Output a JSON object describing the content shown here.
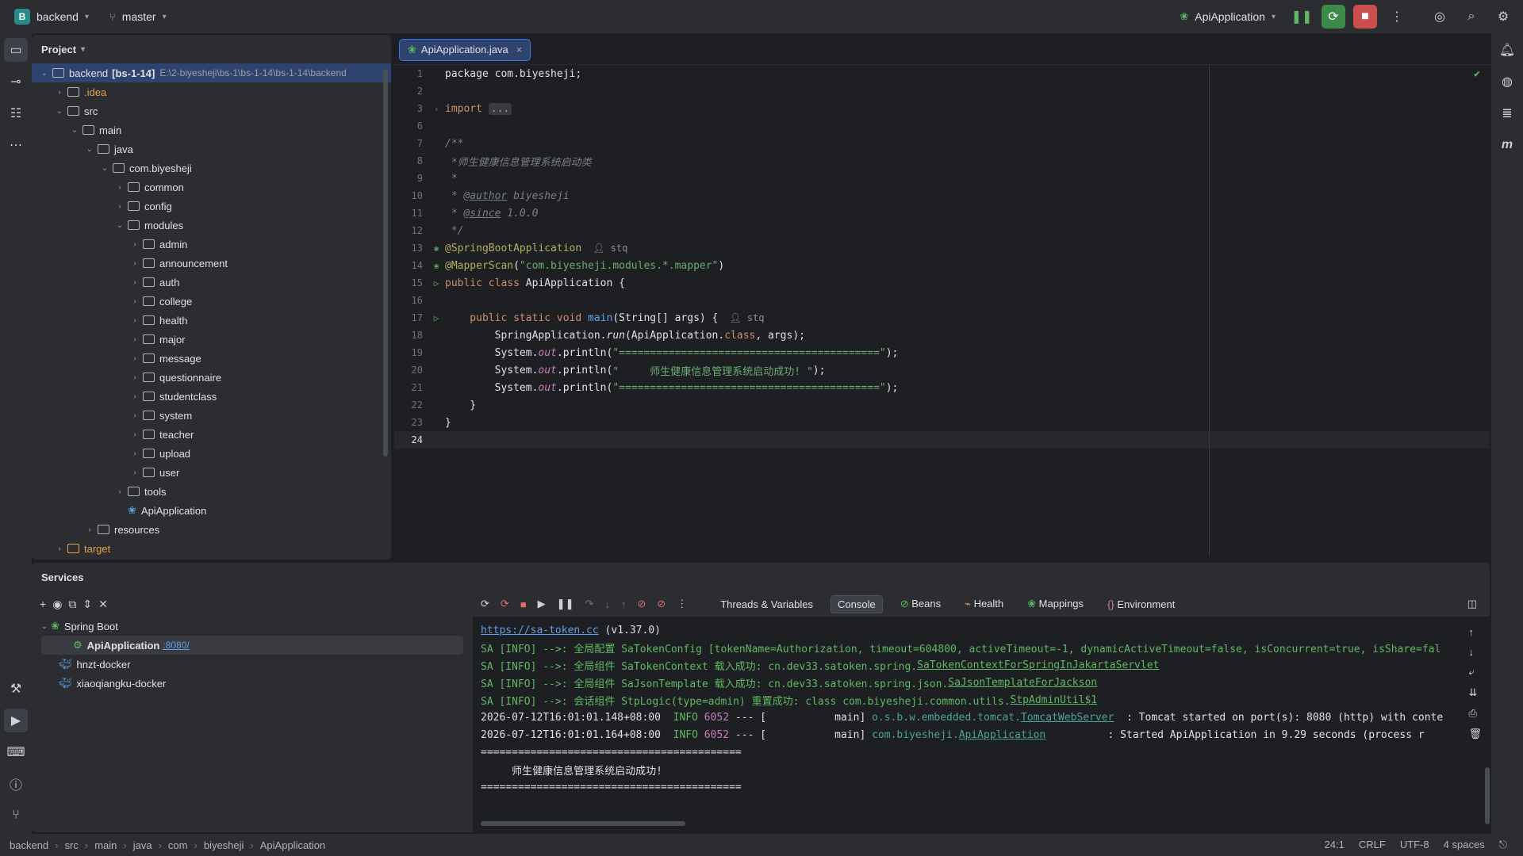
{
  "titlebar": {
    "project_badge": "B",
    "project_name": "backend",
    "branch_name": "master",
    "run_config": "ApiApplication"
  },
  "project_panel": {
    "title": "Project",
    "root_label": "backend",
    "root_module": "[bs-1-14]",
    "root_path": "E:\\2-biyesheji\\bs-1\\bs-1-14\\bs-1-14\\backend",
    "items": [
      {
        "label": ".idea",
        "depth": 1,
        "expanded": false,
        "type": "folder"
      },
      {
        "label": "src",
        "depth": 1,
        "expanded": true,
        "type": "folder"
      },
      {
        "label": "main",
        "depth": 2,
        "expanded": true,
        "type": "folder"
      },
      {
        "label": "java",
        "depth": 3,
        "expanded": true,
        "type": "folder"
      },
      {
        "label": "com.biyesheji",
        "depth": 4,
        "expanded": true,
        "type": "package"
      },
      {
        "label": "common",
        "depth": 5,
        "expanded": false,
        "type": "package"
      },
      {
        "label": "config",
        "depth": 5,
        "expanded": false,
        "type": "package"
      },
      {
        "label": "modules",
        "depth": 5,
        "expanded": true,
        "type": "package"
      },
      {
        "label": "admin",
        "depth": 6,
        "expanded": false,
        "type": "package"
      },
      {
        "label": "announcement",
        "depth": 6,
        "expanded": false,
        "type": "package"
      },
      {
        "label": "auth",
        "depth": 6,
        "expanded": false,
        "type": "package"
      },
      {
        "label": "college",
        "depth": 6,
        "expanded": false,
        "type": "package"
      },
      {
        "label": "health",
        "depth": 6,
        "expanded": false,
        "type": "package"
      },
      {
        "label": "major",
        "depth": 6,
        "expanded": false,
        "type": "package"
      },
      {
        "label": "message",
        "depth": 6,
        "expanded": false,
        "type": "package"
      },
      {
        "label": "questionnaire",
        "depth": 6,
        "expanded": false,
        "type": "package"
      },
      {
        "label": "studentclass",
        "depth": 6,
        "expanded": false,
        "type": "package"
      },
      {
        "label": "system",
        "depth": 6,
        "expanded": false,
        "type": "package"
      },
      {
        "label": "teacher",
        "depth": 6,
        "expanded": false,
        "type": "package"
      },
      {
        "label": "upload",
        "depth": 6,
        "expanded": false,
        "type": "package"
      },
      {
        "label": "user",
        "depth": 6,
        "expanded": false,
        "type": "package"
      },
      {
        "label": "tools",
        "depth": 5,
        "expanded": false,
        "type": "package"
      },
      {
        "label": "ApiApplication",
        "depth": 5,
        "expanded": null,
        "type": "class"
      },
      {
        "label": "resources",
        "depth": 3,
        "expanded": false,
        "type": "folder"
      },
      {
        "label": "target",
        "depth": 1,
        "expanded": false,
        "type": "excluded"
      }
    ]
  },
  "editor": {
    "tab_label": "ApiApplication.java",
    "lines": {
      "l1": "package com.biyesheji;",
      "l3_kw": "import",
      "l3_fold": "...",
      "l7": "/**",
      "l8": " *师生健康信息管理系统启动类",
      "l9": " *",
      "l10_a": " * ",
      "l10_b": "@author",
      "l10_c": " biyesheji",
      "l11_a": " * ",
      "l11_b": "@since",
      "l11_c": " 1.0.0",
      "l12": " */",
      "l13": "@SpringBootApplication",
      "l13_hint": "stq",
      "l14_ann": "@MapperScan",
      "l14_a": "(",
      "l14_str": "\"com.biyesheji.modules.*.mapper\"",
      "l14_b": ")",
      "l15_kw": "public class ",
      "l15_name": "ApiApplication {",
      "l17_kw": "    public static void ",
      "l17_fn": "main",
      "l17_rest": "(String[] args) {",
      "l17_hint": "stq",
      "l18_a": "        SpringApplication.",
      "l18_run": "run",
      "l18_b": "(ApiApplication.",
      "l18_kw": "class",
      "l18_c": ", args);",
      "l19_a": "        System.",
      "l19_out": "out",
      "l19_b": ".println(",
      "l19_str": "\"==========================================\"",
      "l19_c": ");",
      "l20_a": "        System.",
      "l20_out": "out",
      "l20_b": ".println(",
      "l20_str": "\"     师生健康信息管理系统启动成功! \"",
      "l20_c": ");",
      "l21_a": "        System.",
      "l21_out": "out",
      "l21_b": ".println(",
      "l21_str": "\"==========================================\"",
      "l21_c": ");",
      "l22": "    }",
      "l23": "}"
    }
  },
  "services": {
    "title": "Services",
    "tree": {
      "group": "Spring Boot",
      "app": "ApiApplication",
      "app_port": ":8080/",
      "docker1": "hnzt-docker",
      "docker2": "xiaoqiangku-docker"
    },
    "tabs": {
      "threads": "Threads & Variables",
      "console": "Console",
      "beans": "Beans",
      "health": "Health",
      "mappings": "Mappings",
      "environment": "Environment"
    },
    "console": {
      "c1_link": "https://sa-token.cc",
      "c1_rest": " (v1.37.0)",
      "c2": "SA [INFO] -->: 全局配置 SaTokenConfig [tokenName=Authorization, timeout=604800, activeTimeout=-1, dynamicActiveTimeout=false, isConcurrent=true, isShare=fal",
      "c3_a": "SA [INFO] -->: 全局组件 SaTokenContext 载入成功: cn.dev33.satoken.spring.",
      "c3_b": "SaTokenContextForSpringInJakartaServlet",
      "c4_a": "SA [INFO] -->: 全局组件 SaJsonTemplate 载入成功: cn.dev33.satoken.spring.json.",
      "c4_b": "SaJsonTemplateForJackson",
      "c5_a": "SA [INFO] -->: 会话组件 StpLogic(type=admin) 重置成功: class com.biyesheji.common.utils.",
      "c5_b": "StpAdminUtil$1",
      "c6_time": "2026-07-12T16:01:01.148+08:00",
      "c6_level": "INFO",
      "c6_pid": "6052",
      "c6_mid": " --- [           main] ",
      "c6_logger_a": "o.s.b.w.embedded.tomcat.",
      "c6_logger_b": "TomcatWebServer",
      "c6_msg": "  : Tomcat started on port(s): 8080 (http) with conte",
      "c7_time": "2026-07-12T16:01:01.164+08:00",
      "c7_level": "INFO",
      "c7_pid": "6052",
      "c7_mid": " --- [           main] ",
      "c7_logger_a": "com.biyesheji.",
      "c7_logger_b": "ApiApplication",
      "c7_msg": "          : Started ApiApplication in 9.29 seconds (process r",
      "c8": "==========================================",
      "c9": "     师生健康信息管理系统启动成功!",
      "c10": "=========================================="
    }
  },
  "statusbar": {
    "crumbs": [
      "backend",
      "src",
      "main",
      "java",
      "com",
      "biyesheji",
      "ApiApplication"
    ],
    "position": "24:1",
    "line_sep": "CRLF",
    "encoding": "UTF-8",
    "indent": "4 spaces"
  }
}
